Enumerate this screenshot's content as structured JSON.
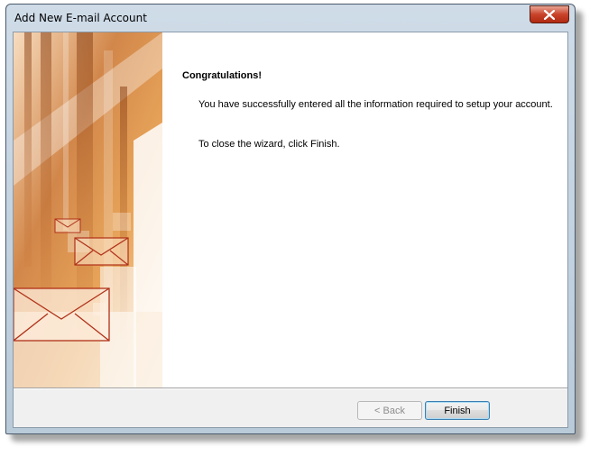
{
  "window": {
    "title": "Add New E-mail Account"
  },
  "icons": {
    "close": "close-icon",
    "banner": "envelope-icon"
  },
  "content": {
    "heading": "Congratulations!",
    "message": "You have successfully entered all the information required to setup your account.",
    "instruction": "To close the wizard, click Finish."
  },
  "buttons": {
    "back_label": "< Back",
    "finish_label": "Finish"
  },
  "colors": {
    "banner_orange": "#d98a3a",
    "close_red": "#c8432a",
    "focus_blue": "#3c7fb1"
  }
}
